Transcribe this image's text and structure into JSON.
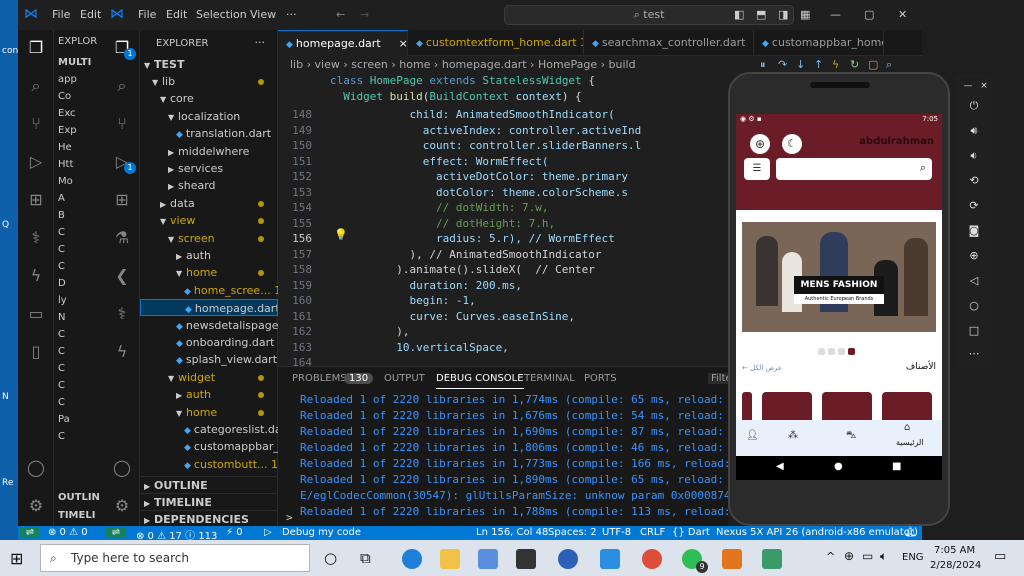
{
  "desktop": {
    "labels": [
      "con",
      "Q",
      "N",
      "Re"
    ]
  },
  "back_window": {
    "menu": [
      "File",
      "Edit"
    ],
    "explorer_label": "EXPLOR",
    "section": "MULTI",
    "items": [
      "app",
      "Co",
      "Exc",
      "Exp",
      "He",
      "Htt",
      "Mo",
      "A",
      "B",
      "C",
      "C",
      "C",
      "D",
      "ly",
      "N",
      "C",
      "C",
      "C",
      "C",
      "C",
      "Pa",
      "C"
    ],
    "bottom": [
      "OUTLIN",
      "TIMELI"
    ]
  },
  "titlebar": {
    "menu": [
      "File",
      "Edit",
      "Selection",
      "View",
      "···"
    ],
    "search": "test"
  },
  "activity_badges": {
    "explorer": "1",
    "run": "1"
  },
  "explorer": {
    "title": "EXPLORER",
    "root": "TEST",
    "rows": [
      {
        "label": "lib",
        "level": 1,
        "type": "folder",
        "open": true,
        "dot": true
      },
      {
        "label": "core",
        "level": 2,
        "type": "folder",
        "open": true
      },
      {
        "label": "localization",
        "level": 3,
        "type": "folder",
        "open": true
      },
      {
        "label": "translation.dart",
        "level": 4,
        "type": "file"
      },
      {
        "label": "middelwhere",
        "level": 3,
        "type": "folder"
      },
      {
        "label": "services",
        "level": 3,
        "type": "folder"
      },
      {
        "label": "sheard",
        "level": 3,
        "type": "folder"
      },
      {
        "label": "data",
        "level": 2,
        "type": "folder",
        "dot": true
      },
      {
        "label": "view",
        "level": 2,
        "type": "folder",
        "open": true,
        "dot": true,
        "warn": true
      },
      {
        "label": "screen",
        "level": 3,
        "type": "folder",
        "open": true,
        "dot": true,
        "warn": true
      },
      {
        "label": "auth",
        "level": 4,
        "type": "folder"
      },
      {
        "label": "home",
        "level": 4,
        "type": "folder",
        "open": true,
        "dot": true,
        "warn": true
      },
      {
        "label": "home_scree... 1",
        "level": 5,
        "type": "file",
        "warn": true
      },
      {
        "label": "homepage.dart",
        "level": 5,
        "type": "file",
        "selected": true
      },
      {
        "label": "newsdetalispage....",
        "level": 4,
        "type": "file"
      },
      {
        "label": "onboarding.dart",
        "level": 4,
        "type": "file"
      },
      {
        "label": "splash_view.dart",
        "level": 4,
        "type": "file"
      },
      {
        "label": "widget",
        "level": 3,
        "type": "folder",
        "open": true,
        "dot": true,
        "warn": true
      },
      {
        "label": "auth",
        "level": 4,
        "type": "folder",
        "dot": true,
        "warn": true
      },
      {
        "label": "home",
        "level": 4,
        "type": "folder",
        "open": true,
        "dot": true,
        "warn": true
      },
      {
        "label": "categoreslist.dart",
        "level": 5,
        "type": "file"
      },
      {
        "label": "customappbar_...",
        "level": 5,
        "type": "file"
      },
      {
        "label": "custombutt... 1",
        "level": 5,
        "type": "file",
        "warn": true
      }
    ],
    "bottom_sections": [
      "OUTLINE",
      "TIMELINE",
      "DEPENDENCIES"
    ]
  },
  "tabs": [
    {
      "label": "homepage.dart",
      "active": true,
      "close": "×"
    },
    {
      "label": "customtextform_home.dart 1",
      "warn": true
    },
    {
      "label": "searchmax_controller.dart"
    },
    {
      "label": "customappbar_home.c"
    }
  ],
  "breadcrumb": [
    "lib",
    "view",
    "screen",
    "home",
    "homepage.dart",
    "HomePage",
    "build"
  ],
  "sticky": [
    {
      "ln": "",
      "code": "class HomePage extends StatelessWidget {"
    },
    {
      "ln": "",
      "code": "  Widget build(BuildContext context) {"
    }
  ],
  "code_lines": [
    {
      "ln": "148",
      "text": "            child: AnimatedSmoothIndicator("
    },
    {
      "ln": "149",
      "text": "              activeIndex: controller.activeInd"
    },
    {
      "ln": "150",
      "text": "              count: controller.sliderBanners.l"
    },
    {
      "ln": "151",
      "text": "              effect: WormEffect("
    },
    {
      "ln": "152",
      "text": "                activeDotColor: theme.primary"
    },
    {
      "ln": "153",
      "text": "                dotColor: theme.colorScheme.s"
    },
    {
      "ln": "154",
      "text": "                // dotWidth: 7.w,"
    },
    {
      "ln": "155",
      "text": "                // dotHeight: 7.h,"
    },
    {
      "ln": "156",
      "text": "                radius: 5.r), // WormEffect"
    },
    {
      "ln": "157",
      "text": "            ), // AnimatedSmoothIndicator"
    },
    {
      "ln": "158",
      "text": "          ).animate().slideX(  // Center"
    },
    {
      "ln": "159",
      "text": "            duration: 200.ms,"
    },
    {
      "ln": "160",
      "text": "            begin: -1,"
    },
    {
      "ln": "161",
      "text": "            curve: Curves.easeInSine,"
    },
    {
      "ln": "162",
      "text": "          ),"
    },
    {
      "ln": "163",
      "text": "          10.verticalSpace,"
    },
    {
      "ln": "164",
      "text": ""
    }
  ],
  "panel": {
    "tabs": [
      "PROBLEMS",
      "130",
      "OUTPUT",
      "DEBUG CONSOLE",
      "TERMINAL",
      "PORTS",
      "Filte"
    ],
    "lines": [
      "Reloaded 1 of 2220 libraries in 1,774ms (compile: 65 ms, reload: 574 m",
      "Reloaded 1 of 2220 libraries in 1,676ms (compile: 54 ms, reload: 543 m",
      "Reloaded 1 of 2220 libraries in 1,690ms (compile: 87 ms, reload: 544 m",
      "Reloaded 1 of 2220 libraries in 1,806ms (compile: 46 ms, reload: 657 m",
      "Reloaded 1 of 2220 libraries in 1,773ms (compile: 166 ms, reload: 567",
      "Reloaded 1 of 2220 libraries in 1,890ms (compile: 65 ms, reload: 847 m",
      "E/eglCodecCommon(30547): glUtilsParamSize: unknow param 0x00008741",
      "Reloaded 1 of 2220 libraries in 1,788ms (compile: 113 ms, reload: 620"
    ],
    "prompt": ">"
  },
  "statusbar": {
    "back_errors": "⊗ 0 ⚠ 0",
    "errors": "⊗ 0 ⚠ 17 ⓘ 113",
    "ports": "⚡ 0",
    "debug": "Debug my code",
    "position": "Ln 156, Col 48",
    "spaces": "Spaces: 2",
    "encoding": "UTF-8",
    "eol": "CRLF",
    "lang": "{} Dart",
    "device": "Nexus 5X API 26 (android-x86 emulator)"
  },
  "phone": {
    "time": "7:05",
    "username": "abdulrahman",
    "banner_text": "MENS FASHION",
    "banner_sub": "Authentic European Brands",
    "section_title": "الأصناف",
    "see_all": "عرض الكل",
    "nav_home": "الرئيسية"
  },
  "taskbar": {
    "search_placeholder": "Type here to search",
    "lang": "ENG",
    "time": "7:05 AM",
    "date": "2/28/2024",
    "whatsapp_badge": "9"
  },
  "colors": {
    "accent": "#0078d4",
    "phone_primary": "#6b1d27",
    "statusbar": "#0078d4"
  }
}
